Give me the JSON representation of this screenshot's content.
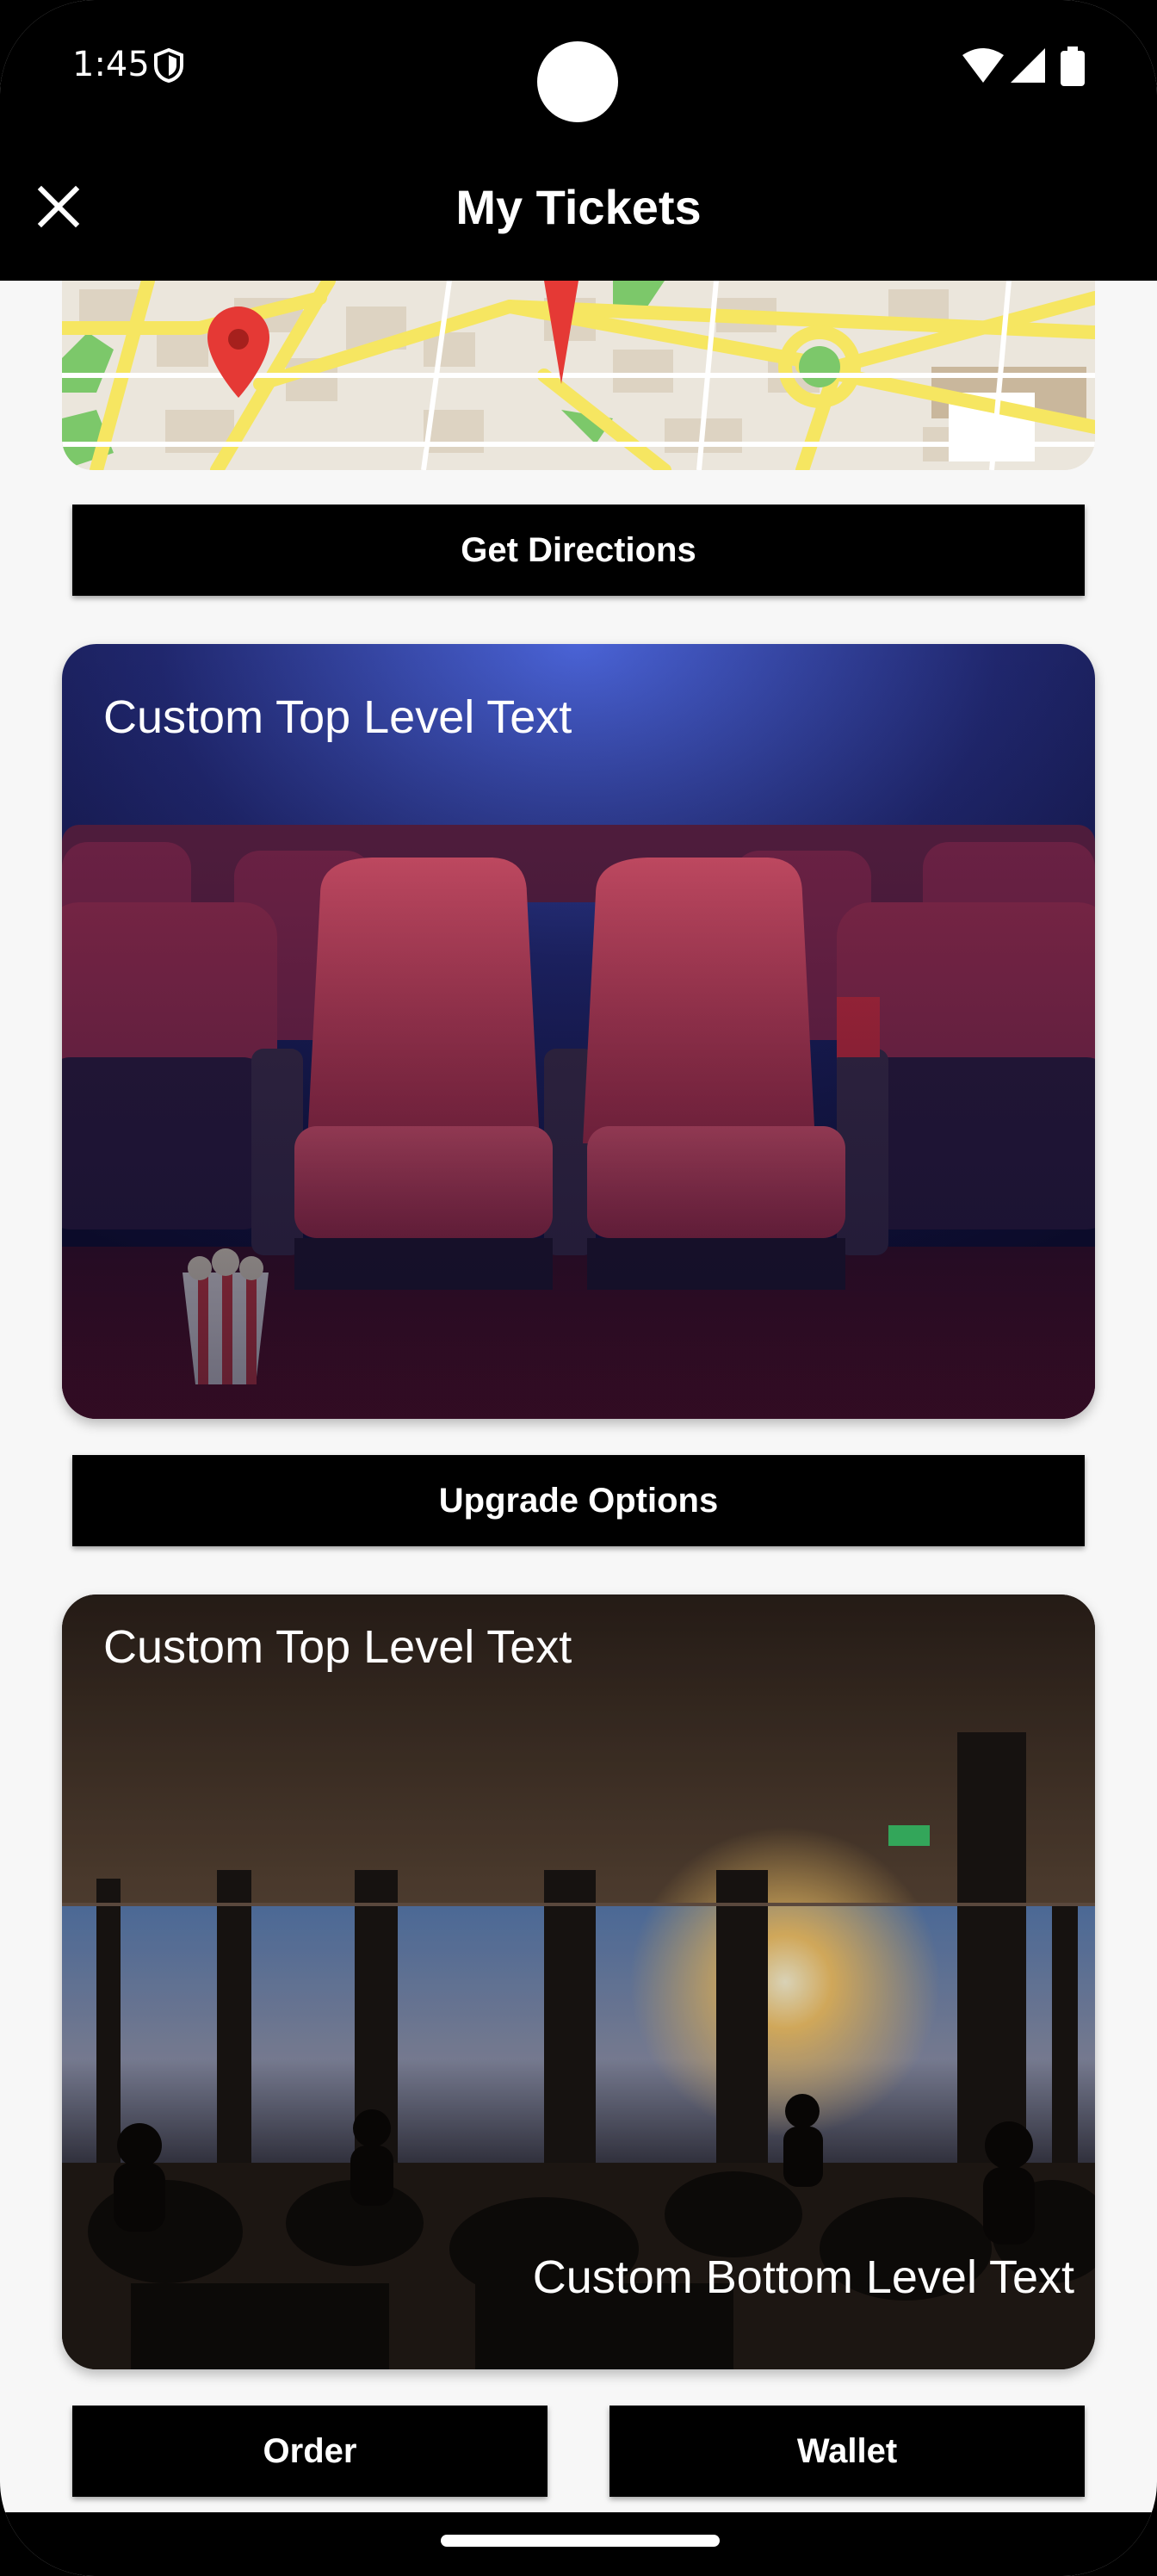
{
  "status_bar": {
    "time": "1:45"
  },
  "app_bar": {
    "title": "My Tickets"
  },
  "buttons": {
    "get_directions": "Get Directions",
    "upgrade_options": "Upgrade Options",
    "order": "Order",
    "wallet": "Wallet"
  },
  "cards": [
    {
      "top_text": "Custom Top Level Text",
      "image": "cinema-seats"
    },
    {
      "top_text": "Custom Top Level Text",
      "bottom_text": "Custom Bottom Level Text",
      "image": "restaurant-interior"
    }
  ],
  "colors": {
    "bar": "#000000",
    "background": "#f7f7f7",
    "map_pin": "#e53935"
  }
}
